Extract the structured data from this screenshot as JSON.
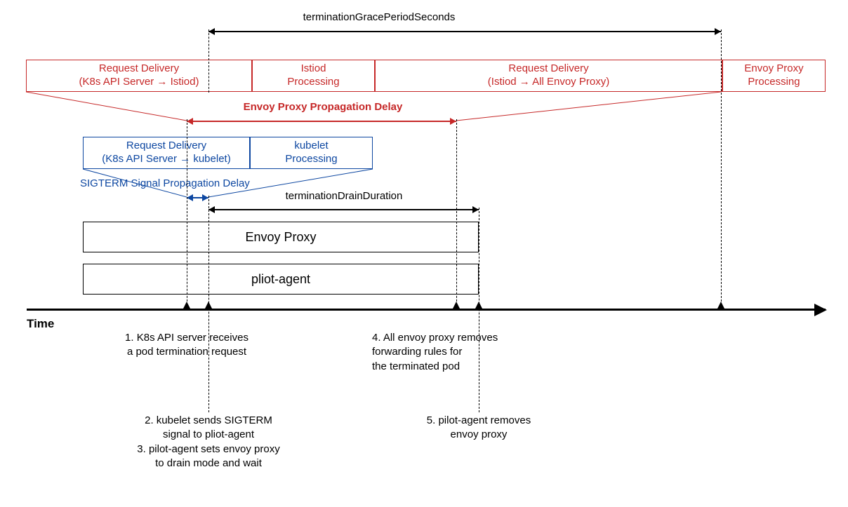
{
  "top": {
    "grace_label": "terminationGracePeriodSeconds",
    "envoy_delay_label": "Envoy Proxy Propagation Delay",
    "box1_l1": "Request Delivery",
    "box1_l2": "(K8s API Server → Istiod)",
    "box2_l1": "Istiod",
    "box2_l2": "Processing",
    "box3_l1": "Request Delivery",
    "box3_l2": "(Istiod → All Envoy Proxy)",
    "box4_l1": "Envoy Proxy",
    "box4_l2": "Processing"
  },
  "mid": {
    "sigterm_label": "SIGTERM Signal Propagation Delay",
    "drain_label": "terminationDrainDuration",
    "box1_l1": "Request Delivery",
    "box1_l2": "(K8s API Server → kubelet)",
    "box2_l1": "kubelet",
    "box2_l2": "Processing",
    "envoy_proxy": "Envoy Proxy",
    "pilot_agent": "pliot-agent"
  },
  "axis": {
    "time_label": "Time"
  },
  "steps": {
    "s1_l1": "1. K8s API server receives",
    "s1_l2": "a pod termination request",
    "s2_l1": "2. kubelet sends SIGTERM",
    "s2_l2": "signal to pliot-agent",
    "s3_l1": "3. pilot-agent sets envoy proxy",
    "s3_l2": "to drain mode and wait",
    "s4_l1": "4. All envoy proxy removes",
    "s4_l2": "forwarding rules for",
    "s4_l3": "the terminated pod",
    "s5_l1": "5. pilot-agent removes",
    "s5_l2": "envoy proxy"
  },
  "x": {
    "t1": 266,
    "t2": 297,
    "t3": 650,
    "t4": 682,
    "t5": 1027
  }
}
